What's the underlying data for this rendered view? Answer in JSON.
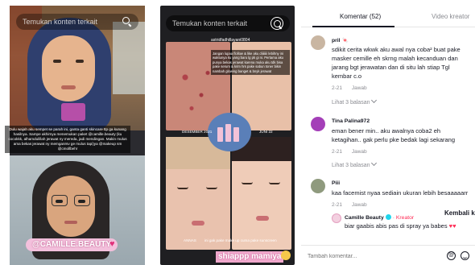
{
  "left_card": {
    "search_placeholder": "Temukan konten terkait",
    "caption": "Dulu wajah aku sempet se parah ini, ganta ganti skincare ttp ga kunang hasilnya. Sampe akhirnya menemukan paket @camille.beauty (ku cocokkk, alhamdulillah jerawat ny mereda, jadi mendingan. Makin mulus ama bekas jerawat ny memganrsv ge mulus tapi)ya @makeup sm @cmollbehr",
    "brand_tag": "@CAMILLE.BEAUTY",
    "heart": "♥"
  },
  "middle_card": {
    "search_placeholder": "Temukan konten terkait",
    "username": "astridfadhillayani0804",
    "caption": "Jangan lupaa flollow & like aku diiiiiiii lebihny ini waktunya ku yang baru lg pk gi ni. Pertama aku punya bekas jerawat karena muka aku tdk bisa pake serum & krim hrs pake sabun toner bikin nambah glowing banget & bnyk jerawat",
    "date_left": "DESEMBER 2021",
    "date_right": "JUNI 22",
    "photo_label": "ANNAS",
    "note": "ini gak pake make up cuma pake sunscreen",
    "brand_tag": "shiappp mamiya"
  },
  "panel": {
    "tabs": [
      {
        "label": "Komentar (52)",
        "active": true
      },
      {
        "label": "Video kreator",
        "active": false
      }
    ],
    "comments": [
      {
        "user": "pril",
        "badge": "🍬",
        "lines": [
          "sdikit cerita wkwk aku awal nya coba² buat pake",
          "masker cemille eh skrng malah kecanduan dan",
          "jarang bgt jerawatan dan di situ lah stiap Tgl",
          "kembar c.o"
        ],
        "date": "2-21",
        "reply": "Jawab",
        "more": "Lihat 3 balasan"
      },
      {
        "user": "Tina Palina972",
        "badge": "",
        "lines": [
          "eman bener min.. aku awalnya coba2 eh",
          "ketagihan.. gak perlu pke bedak lagi sekarang"
        ],
        "date": "2-21",
        "reply": "Jawab",
        "more": "Lihat 3 balasan"
      },
      {
        "user": "Piii",
        "badge": "",
        "lines": [
          "kaa facemist nyaa sediain ukuran lebih besaaaaarr"
        ],
        "date": "2-21",
        "reply": "Jawab",
        "more": ""
      }
    ],
    "creator_reply": {
      "user": "Camille Beauty",
      "creator_label": "· Kreator",
      "text": "biar gaabis abis pas di spray ya babes",
      "hearts": "♥♥"
    },
    "back_label": "Kembali k",
    "input_placeholder": "Tambah komentar...",
    "at_symbol": "@"
  }
}
